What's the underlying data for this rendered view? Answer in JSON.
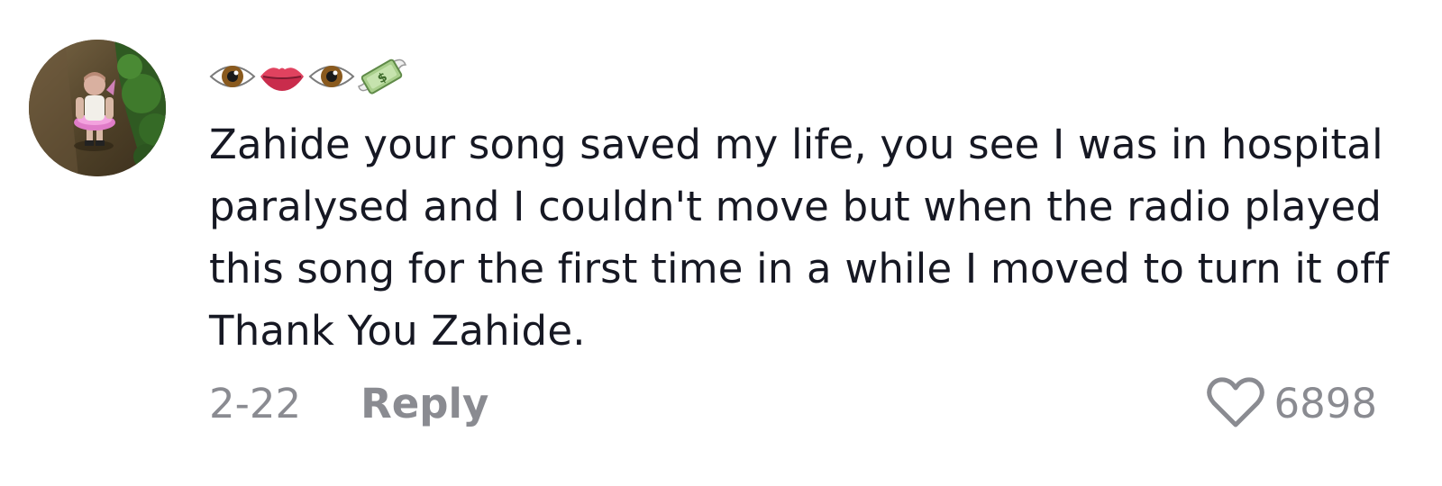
{
  "comment": {
    "avatar_icon": "user-avatar-fairy-character",
    "username_icons": [
      "eye-emoji",
      "lips-emoji",
      "eye-emoji",
      "money-with-wings-emoji"
    ],
    "text": "Zahide your song saved my life, you see I was in hospital paralysed and I couldn't move but when the radio played this song for the first time in a while I moved to turn it off Thank You Zahide.",
    "date": "2-22",
    "reply_label": "Reply",
    "likes": "6898"
  },
  "colors": {
    "text": "#161823",
    "secondary": "#8a8b91",
    "background": "#ffffff"
  }
}
